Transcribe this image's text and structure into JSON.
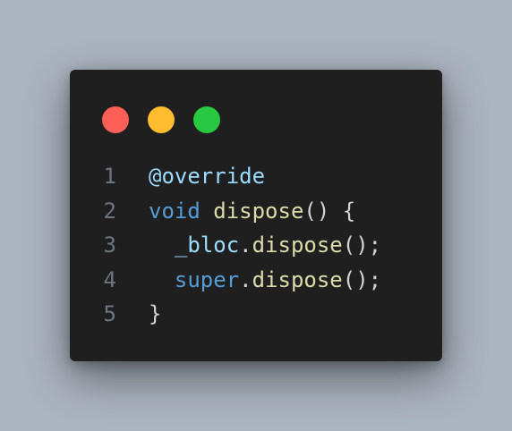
{
  "colors": {
    "background": "#aab4bf",
    "window": "#1f1f1f",
    "red_light": "#ff5f57",
    "yellow_light": "#febc2e",
    "green_light": "#28c840",
    "line_number": "#6e7681",
    "annotation": "#9cdcfe",
    "keyword": "#569cd6",
    "function": "#dcdcaa",
    "punct": "#d4d4d4",
    "variable": "#9cdcfe"
  },
  "lines": [
    {
      "num": "1",
      "tokens": [
        {
          "t": "@override",
          "c": "annotation"
        }
      ]
    },
    {
      "num": "2",
      "tokens": [
        {
          "t": "void",
          "c": "keyword"
        },
        {
          "t": " ",
          "c": "punct"
        },
        {
          "t": "dispose",
          "c": "function"
        },
        {
          "t": "() {",
          "c": "punct"
        }
      ]
    },
    {
      "num": "3",
      "tokens": [
        {
          "t": "  ",
          "c": "punct"
        },
        {
          "t": "_bloc",
          "c": "variable"
        },
        {
          "t": ".",
          "c": "punct"
        },
        {
          "t": "dispose",
          "c": "function"
        },
        {
          "t": "();",
          "c": "punct"
        }
      ]
    },
    {
      "num": "4",
      "tokens": [
        {
          "t": "  ",
          "c": "punct"
        },
        {
          "t": "super",
          "c": "keyword"
        },
        {
          "t": ".",
          "c": "punct"
        },
        {
          "t": "dispose",
          "c": "function"
        },
        {
          "t": "();",
          "c": "punct"
        }
      ]
    },
    {
      "num": "5",
      "tokens": [
        {
          "t": "}",
          "c": "punct"
        }
      ]
    }
  ]
}
